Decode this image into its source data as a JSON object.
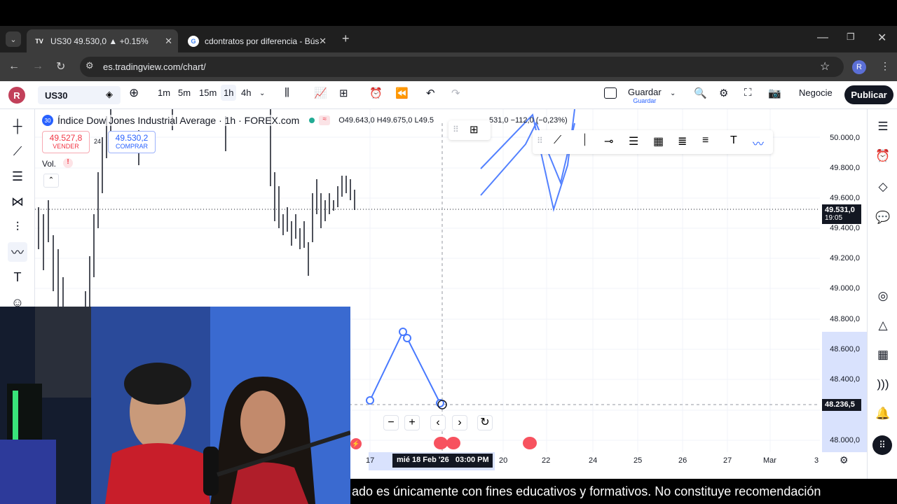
{
  "browser": {
    "tabs": [
      {
        "label": "US30 49.530,0 ▲ +0.15%",
        "active": true
      },
      {
        "label": "cdontratos por diferencia - Bús",
        "active": false
      }
    ],
    "url": "es.tradingview.com/chart/",
    "profile_initial": "R"
  },
  "toolbar": {
    "user_initial": "R",
    "symbol": "US30",
    "intervals": [
      "1m",
      "5m",
      "15m",
      "1h",
      "4h"
    ],
    "active_interval": "1h",
    "save_label": "Guardar",
    "save_sub": "Guardar",
    "trade_label": "Negocie",
    "publish_label": "Publicar"
  },
  "legend": {
    "badge": "30",
    "title": "Índice Dow Jones Industrial Average · 1h · FOREX.com",
    "ohlc": "O49.643,0 H49.675,0 L49.5",
    "change": "531,0 −112,0 (−0,23%)",
    "sell_price": "49.527,8",
    "sell_label": "VENDER",
    "spread": "24",
    "buy_price": "49.530,2",
    "buy_label": "COMPRAR",
    "vol_label": "Vol.",
    "vol_alert": "!"
  },
  "price_axis": {
    "labels": [
      "50.000,0",
      "49.800,0",
      "49.600,0",
      "49.400,0",
      "49.200,0",
      "49.000,0",
      "48.800,0",
      "48.600,0",
      "48.400,0",
      "48.000,0"
    ],
    "current_price": "49.531,0",
    "countdown": "19:05",
    "cursor_price": "48.236,5"
  },
  "time_axis": {
    "labels": [
      "17",
      "20",
      "22",
      "24",
      "25",
      "26",
      "27",
      "Mar",
      "3"
    ],
    "cursor_label": "mié 18 Feb '26   03:00 PM"
  },
  "subtitle": "ado es únicamente con fines educativos y formativos. No constituye recomendación"
}
